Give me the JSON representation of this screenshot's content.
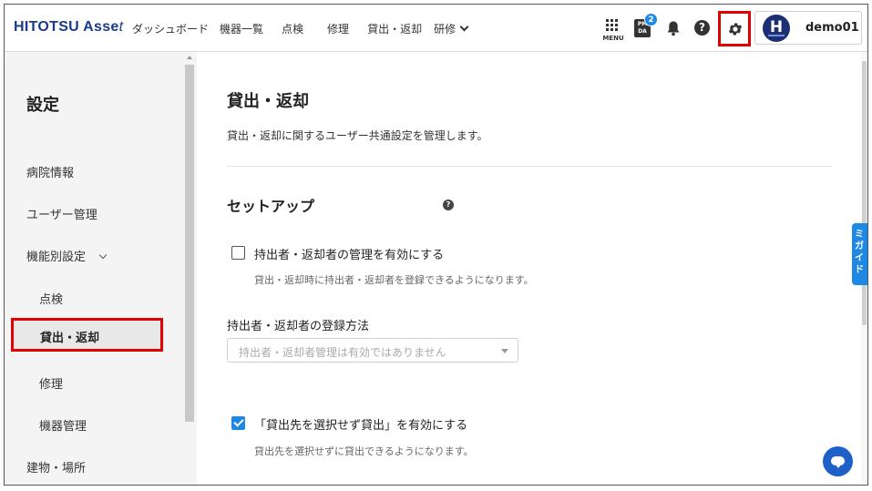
{
  "header": {
    "logo_main": "HITOTSU Asse",
    "logo_tail": "t",
    "nav": [
      "ダッシュボード",
      "機器一覧",
      "点検",
      "修理",
      "貸出・返却",
      "研修"
    ],
    "menu_label": "MENU",
    "pmda_label": "PM DA",
    "pmda_badge": "2",
    "help_glyph": "?",
    "avatar_letter": "H",
    "username": "demo01"
  },
  "sidebar": {
    "title": "設定",
    "items": [
      "病院情報",
      "ユーザー管理",
      "機能別設定",
      "点検",
      "貸出・返却",
      "修理",
      "機器管理",
      "建物・場所"
    ],
    "active": "貸出・返却"
  },
  "main": {
    "title": "貸出・返却",
    "description": "貸出・返却に関するユーザー共通設定を管理します。",
    "section_title": "セットアップ",
    "section_help": "?",
    "option1": {
      "label": "持出者・返却者の管理を有効にする",
      "help": "貸出・返却時に持出者・返却者を登録できるようになります。",
      "checked": false
    },
    "field_label": "持出者・返却者の登録方法",
    "select_placeholder": "持出者・返却者管理は有効ではありません",
    "option2": {
      "label": "「貸出先を選択せず貸出」を有効にする",
      "help": "貸出先を選択せずに貸出できるようになります。",
      "checked": true
    }
  },
  "guide_tab": "ミガイド",
  "colors": {
    "accent": "#1e88e5",
    "highlight": "#e00000",
    "logo": "#1b3a8c",
    "avatar": "#1b2f72"
  }
}
